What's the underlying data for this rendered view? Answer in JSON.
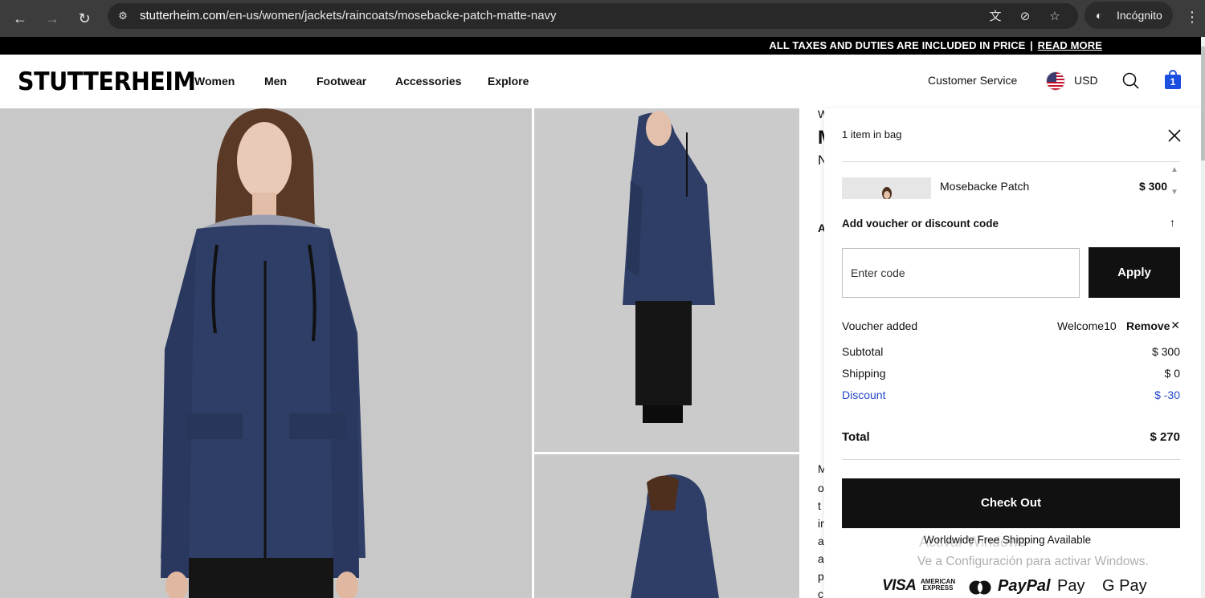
{
  "browser": {
    "url_host": "stutterheim.com",
    "url_path": "/en-us/women/jackets/raincoats/mosebacke-patch-matte-navy",
    "incognito_label": "Incógnito"
  },
  "promo": {
    "text": "ALL TAXES AND DUTIES ARE INCLUDED IN PRICE",
    "separator": "|",
    "link": "READ MORE"
  },
  "header": {
    "logo": "STUTTERHEIM",
    "nav": [
      "Women",
      "Men",
      "Footwear",
      "Accessories",
      "Explore"
    ],
    "customer_service": "Customer Service",
    "currency": "USD",
    "bag_count": "1"
  },
  "peek": {
    "chars": [
      "W",
      "M",
      "N",
      "A",
      "M",
      "o",
      "t",
      "in",
      "a",
      "a",
      "p",
      "c"
    ]
  },
  "cart": {
    "title": "1 item in bag",
    "item": {
      "name": "Mosebacke Patch",
      "price": "$ 300"
    },
    "voucher_title": "Add voucher or discount code",
    "code_placeholder": "Enter code",
    "apply_label": "Apply",
    "voucher_added_label": "Voucher added",
    "voucher_code": "Welcome10",
    "remove_label": "Remove",
    "subtotal_label": "Subtotal",
    "subtotal_value": "$ 300",
    "shipping_label": "Shipping",
    "shipping_value": "$ 0",
    "discount_label": "Discount",
    "discount_value": "$ -30",
    "total_label": "Total",
    "total_value": "$ 270",
    "checkout_label": "Check Out",
    "shipping_note": "Worldwide Free Shipping Available",
    "payment_methods": {
      "visa": "VISA",
      "amex_1": "AMERICAN",
      "amex_2": "EXPRESS",
      "paypal": "PayPal",
      "applepay": " Pay",
      "gpay": "G Pay"
    }
  },
  "os_watermark": {
    "line1": "Activar Windows",
    "line2": "Ve a Configuración para activar Windows."
  },
  "colors": {
    "accent_blue": "#1b4fe0",
    "discount_blue": "#2446c8",
    "jacket_navy": "#2d3c63"
  }
}
